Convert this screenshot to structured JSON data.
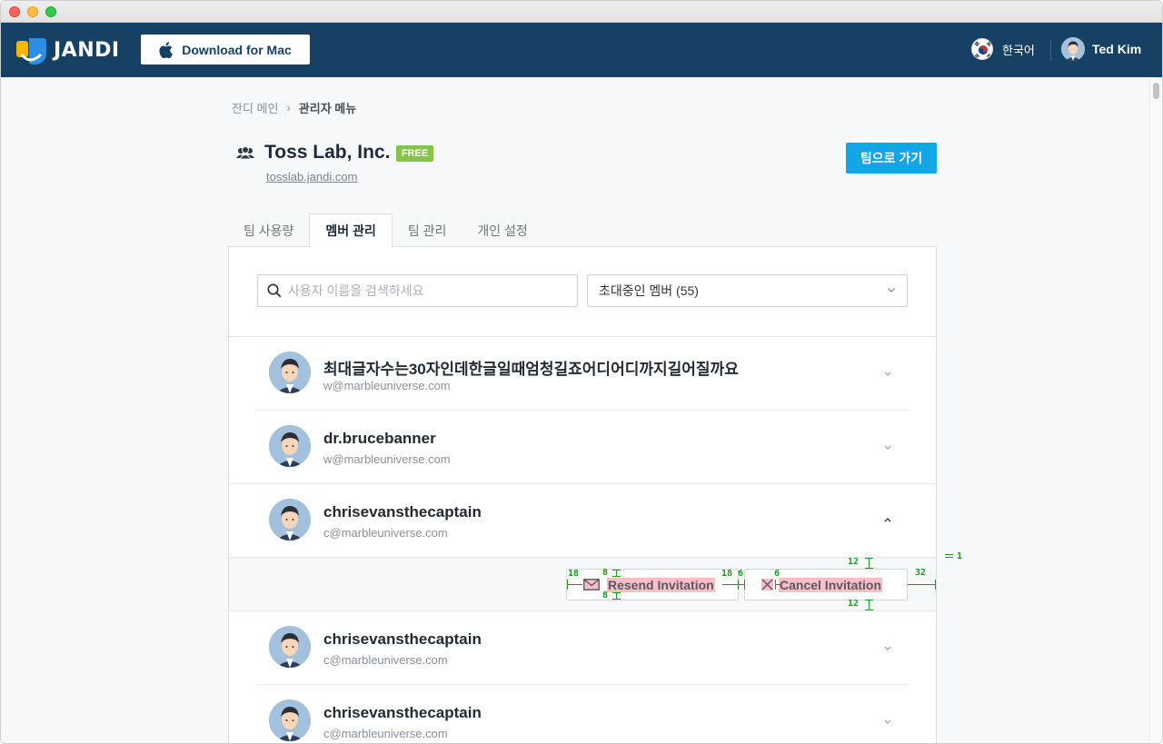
{
  "header": {
    "logo_text": "JANDI",
    "download_label": "Download for Mac",
    "language": "한국어",
    "user_name": "Ted Kim"
  },
  "breadcrumb": {
    "home": "잔디 메인",
    "separator": "›",
    "current": "관리자 메뉴"
  },
  "team": {
    "name": "Toss Lab, Inc.",
    "plan_badge": "FREE",
    "url": "tosslab.jandi.com",
    "goto_label": "팀으로 가기"
  },
  "tabs": [
    {
      "label": "팀 사용량",
      "active": false
    },
    {
      "label": "멤버 관리",
      "active": true
    },
    {
      "label": "팀 관리",
      "active": false
    },
    {
      "label": "개인 설정",
      "active": false
    }
  ],
  "search": {
    "placeholder": "사용자 이름을 검색하세요"
  },
  "filter": {
    "selected": "초대중인 멤버 (55)"
  },
  "members": [
    {
      "name": "최대글자수는30자인데한글일때엄청길죠어디어디까지길어질까요",
      "email": "w@marbleuniverse.com",
      "expanded": false
    },
    {
      "name": "dr.brucebanner",
      "email": "w@marbleuniverse.com",
      "expanded": false
    },
    {
      "name": "chrisevansthecaptain",
      "email": "c@marbleuniverse.com",
      "expanded": true
    },
    {
      "name": "chrisevansthecaptain",
      "email": "c@marbleuniverse.com",
      "expanded": false
    },
    {
      "name": "chrisevansthecaptain",
      "email": "c@marbleuniverse.com",
      "expanded": false
    }
  ],
  "actions": {
    "resend_label": "Resend Invitation",
    "cancel_label": "Cancel Invitation"
  },
  "spec_annotations": {
    "resend_pad_left": "18",
    "resend_pad_right": "18",
    "icon_gap_top": "8",
    "icon_gap_bottom": "8",
    "button_gap": "6",
    "cancel_icon_gap": "6",
    "row_pad_top": "12",
    "row_pad_bottom": "12",
    "right_margin": "32",
    "border_width": "1"
  },
  "colors": {
    "topbar": "#164064",
    "accent": "#14a5e8",
    "free_badge": "#86c34a",
    "spec_green": "#1a9a1a"
  }
}
